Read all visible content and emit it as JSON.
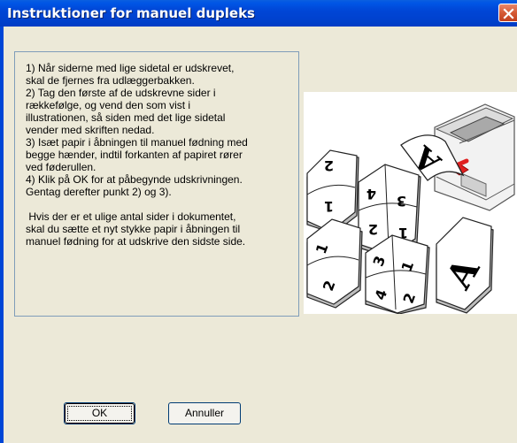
{
  "window": {
    "title": "Instruktioner for manuel dupleks"
  },
  "instructions": {
    "text": "1) Når siderne med lige sidetal er udskrevet,\nskal de fjernes fra udlæggerbakken.\n2) Tag den første af de udskrevne sider i\nrækkefølge, og vend den som vist i\nillustrationen, så siden med det lige sidetal\nvender med skriften nedad.\n3) Isæt papir i åbningen til manuel fødning med\nbegge hænder, indtil forkanten af papiret rører\nved føderullen.\n4) Klik på OK for at påbegynde udskrivningen.\nGentag derefter punkt 2) og 3).\n\n Hvis der er et ulige antal sider i dokumentet,\nskal du sætte et nyt stykke papir i åbningen til\nmanuel fødning for at udskrive den sidste side."
  },
  "buttons": {
    "ok": "OK",
    "cancel": "Annuller"
  },
  "icons": {
    "close": "close-icon",
    "illustration": "manual-duplex-illustration"
  },
  "colors": {
    "titlebar": "#0046d6",
    "close": "#d55a35",
    "dialog": "#ece9d8"
  }
}
